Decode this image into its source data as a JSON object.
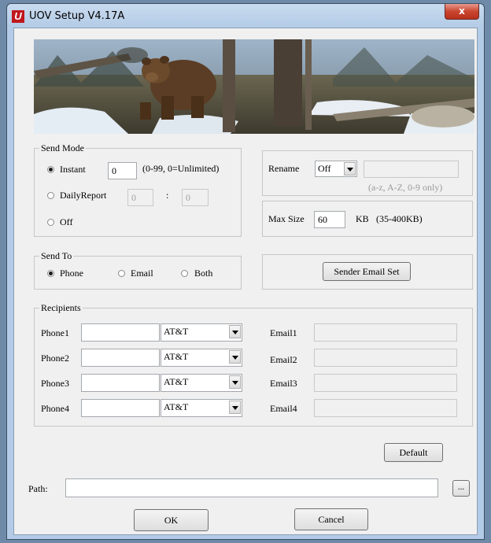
{
  "window": {
    "title": "UOV Setup V4.17A",
    "close_label": "x",
    "icon_letter": "U"
  },
  "send_mode": {
    "legend": "Send Mode",
    "instant_label": "Instant",
    "instant_value": "0",
    "instant_hint": "(0-99, 0=Unlimited)",
    "daily_label": "DailyReport",
    "daily_hour": "0",
    "daily_sep": ":",
    "daily_minute": "0",
    "off_label": "Off",
    "selected": "Instant"
  },
  "rename": {
    "label": "Rename",
    "value": "Off",
    "text_value": "",
    "hint": "(a-z, A-Z, 0-9 only)"
  },
  "max_size": {
    "label": "Max Size",
    "value": "60",
    "unit": "KB",
    "range": "(35-400KB)"
  },
  "send_to": {
    "legend": "Send To",
    "options": [
      "Phone",
      "Email",
      "Both"
    ],
    "selected": "Phone"
  },
  "sender_email_button": "Sender Email Set",
  "recipients": {
    "legend": "Recipients",
    "rows": [
      {
        "phone_label": "Phone1",
        "phone": "",
        "carrier": "AT&T",
        "email_label": "Email1",
        "email": ""
      },
      {
        "phone_label": "Phone2",
        "phone": "",
        "carrier": "AT&T",
        "email_label": "Email2",
        "email": ""
      },
      {
        "phone_label": "Phone3",
        "phone": "",
        "carrier": "AT&T",
        "email_label": "Email3",
        "email": ""
      },
      {
        "phone_label": "Phone4",
        "phone": "",
        "carrier": "AT&T",
        "email_label": "Email4",
        "email": ""
      }
    ]
  },
  "default_button": "Default",
  "path": {
    "label": "Path:",
    "value": "",
    "browse_label": "..."
  },
  "ok_button": "OK",
  "cancel_button": "Cancel"
}
